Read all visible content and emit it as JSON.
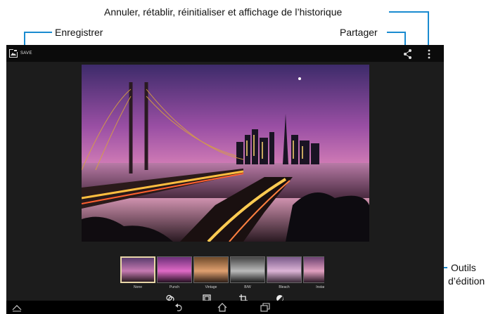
{
  "callouts": {
    "history": "Annuler, rétablir, réinitialiser et affichage de l’historique",
    "save": "Enregistrer",
    "share": "Partager",
    "tools_line1": "Outils",
    "tools_line2": "d’édition"
  },
  "actionbar": {
    "save_label": "SAVE",
    "icons": [
      "save-icon",
      "share-icon",
      "overflow-menu-icon"
    ]
  },
  "filters": [
    {
      "label": "None",
      "selected": true
    },
    {
      "label": "Punch",
      "selected": false
    },
    {
      "label": "Vintage",
      "selected": false
    },
    {
      "label": "B/W",
      "selected": false
    },
    {
      "label": "Bleach",
      "selected": false
    },
    {
      "label": "Instan",
      "selected": false
    }
  ],
  "tools": [
    "filters-tool-icon",
    "borders-tool-icon",
    "crop-tool-icon",
    "adjust-tool-icon"
  ],
  "navbar": [
    "collapse-icon",
    "back-icon",
    "home-icon",
    "recent-apps-icon"
  ],
  "colors": {
    "accent": "#1a8bd0",
    "tab_active": "#2aa4dc",
    "frame_selected": "#e8d7a8"
  }
}
